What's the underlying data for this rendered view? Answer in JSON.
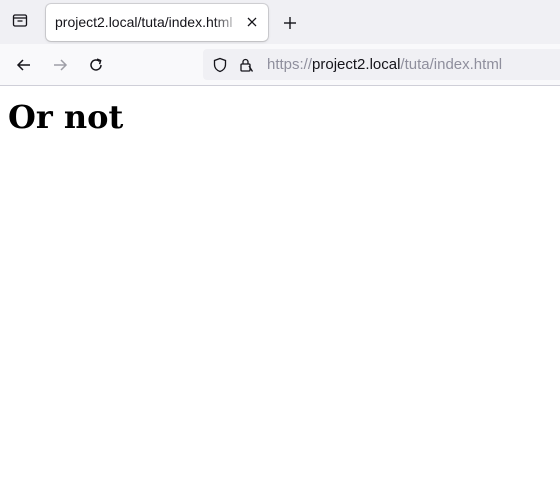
{
  "tab_strip": {
    "tab_list_icon": "tab-list-icon",
    "active_tab": {
      "title": "project2.local/tuta/index.html",
      "close_icon": "close-icon"
    },
    "new_tab_icon": "plus-icon"
  },
  "nav_bar": {
    "back_icon": "arrow-left-icon",
    "forward_icon": "arrow-right-icon",
    "reload_icon": "reload-icon",
    "url": {
      "scheme": "https://",
      "host": "project2.local",
      "path": "/tuta/index.html"
    },
    "shield_icon": "shield-icon",
    "lock_icon": "lock-icon"
  },
  "page": {
    "heading": "Or not"
  }
}
